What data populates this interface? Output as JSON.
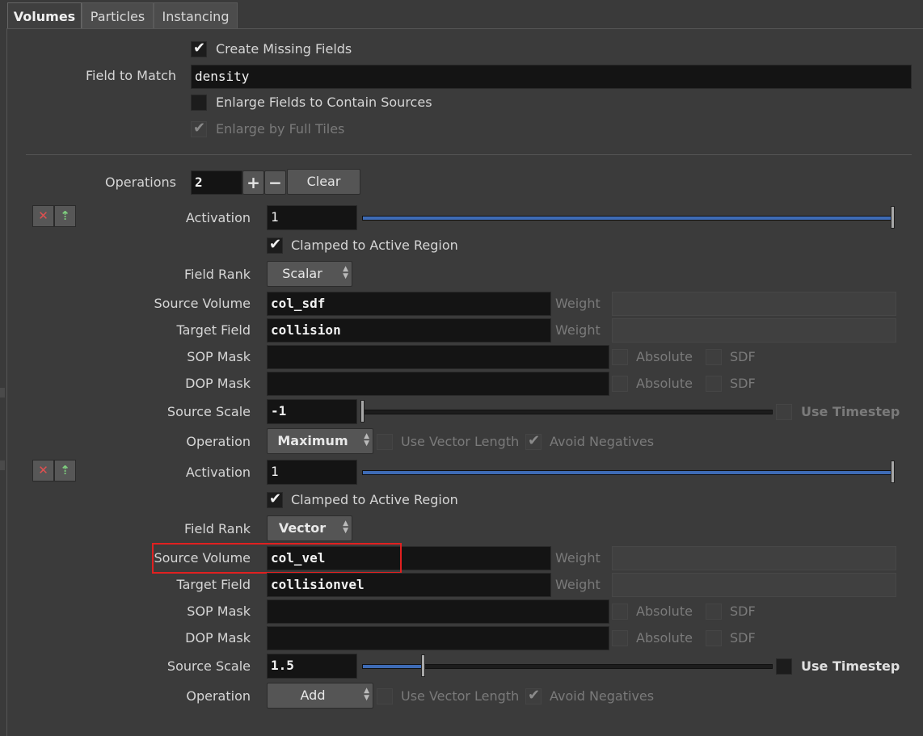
{
  "tabs": [
    {
      "label": "Volumes"
    },
    {
      "label": "Particles"
    },
    {
      "label": "Instancing"
    }
  ],
  "top": {
    "create_missing": {
      "label": "Create Missing Fields",
      "checked": true
    },
    "field_to_match": {
      "label": "Field to Match",
      "value": "density"
    },
    "enlarge_fields": {
      "label": "Enlarge Fields to Contain Sources",
      "checked": false
    },
    "enlarge_full_tiles": {
      "label": "Enlarge by Full Tiles",
      "checked": true,
      "disabled": true
    }
  },
  "operations": {
    "label": "Operations",
    "value": "2",
    "plus": "+",
    "minus": "−",
    "clear": "Clear"
  },
  "blocks": [
    {
      "activation": {
        "label": "Activation",
        "value": "1",
        "slider_fraction": 1.0
      },
      "clamped": {
        "label": "Clamped to Active Region",
        "checked": true
      },
      "field_rank": {
        "label": "Field Rank",
        "value": "Scalar"
      },
      "source_volume": {
        "label": "Source Volume",
        "value": "col_sdf",
        "weight_label": "Weight"
      },
      "target_field": {
        "label": "Target Field",
        "value": "collision",
        "weight_label": "Weight"
      },
      "sop_mask": {
        "label": "SOP Mask",
        "value": "",
        "absolute": "Absolute",
        "sdf": "SDF"
      },
      "dop_mask": {
        "label": "DOP Mask",
        "value": "",
        "absolute": "Absolute",
        "sdf": "SDF"
      },
      "source_scale": {
        "label": "Source Scale",
        "value": "-1",
        "slider_fraction": 0.0,
        "use_timestep": "Use Timestep"
      },
      "operation": {
        "label": "Operation",
        "value": "Maximum",
        "use_vector_length": "Use Vector Length",
        "avoid_negatives": "Avoid Negatives"
      }
    },
    {
      "activation": {
        "label": "Activation",
        "value": "1",
        "slider_fraction": 1.0
      },
      "clamped": {
        "label": "Clamped to Active Region",
        "checked": true
      },
      "field_rank": {
        "label": "Field Rank",
        "value": "Vector"
      },
      "source_volume": {
        "label": "Source Volume",
        "value": "col_vel",
        "weight_label": "Weight"
      },
      "target_field": {
        "label": "Target Field",
        "value": "collisionvel",
        "weight_label": "Weight"
      },
      "sop_mask": {
        "label": "SOP Mask",
        "value": "",
        "absolute": "Absolute",
        "sdf": "SDF"
      },
      "dop_mask": {
        "label": "DOP Mask",
        "value": "",
        "absolute": "Absolute",
        "sdf": "SDF"
      },
      "source_scale": {
        "label": "Source Scale",
        "value": "1.5",
        "slider_fraction": 0.15,
        "use_timestep": "Use Timestep"
      },
      "operation": {
        "label": "Operation",
        "value": "Add",
        "use_vector_length": "Use Vector Length",
        "avoid_negatives": "Avoid Negatives"
      }
    }
  ],
  "icons": {
    "remove": "close-icon",
    "insert": "insert-icon"
  },
  "colors": {
    "highlight": "#e02020",
    "slider_fill": "#3e6bb5"
  }
}
